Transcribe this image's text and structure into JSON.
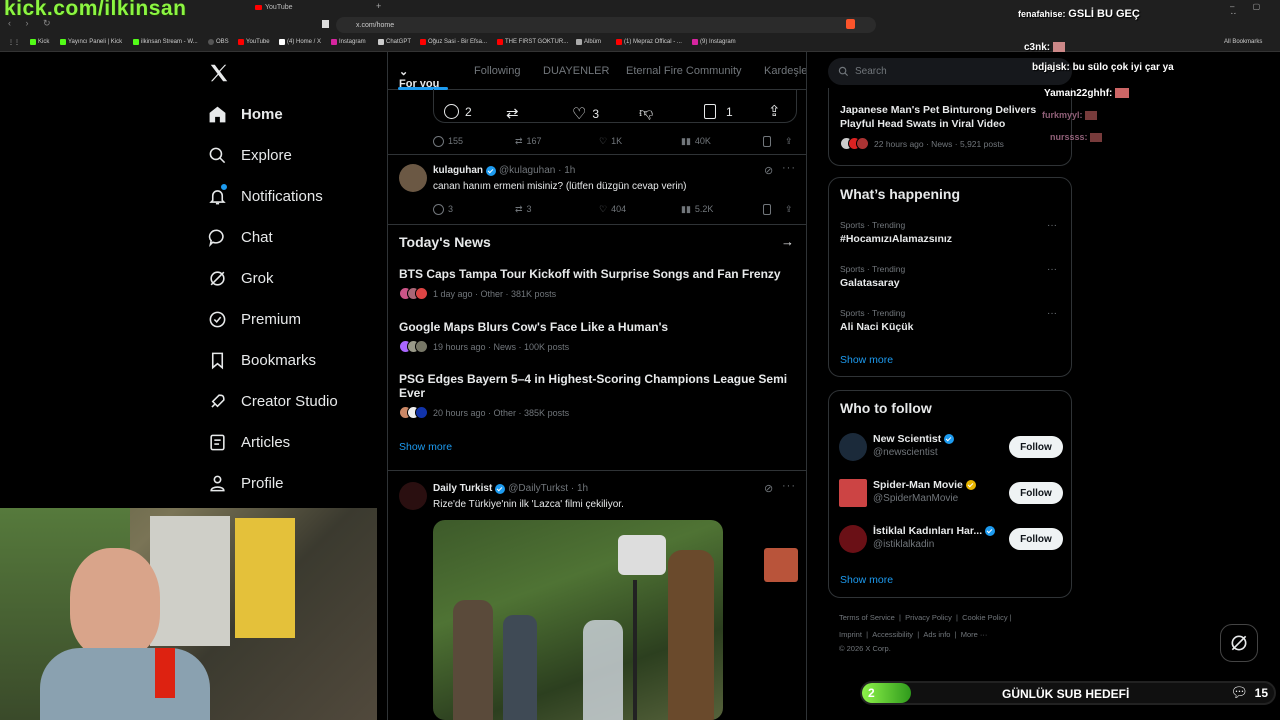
{
  "browser": {
    "overlay_text": "kick.com/ilkinsan",
    "tab_youtube": "YouTube",
    "url": "x.com/home",
    "bookmarks": [
      "Kick",
      "Yayıncı Paneli | Kick",
      "ilkinsan Stream - W...",
      "OBS",
      "YouTube",
      "(4) Home / X",
      "Instagram",
      "ChatGPT",
      "Oğuz Sasi - Bir Efsa...",
      "THE FIRST GOKTUR...",
      "Albüm",
      "(1) Mepraz Offical - ...",
      "(9) Instagram"
    ],
    "all_bookmarks": "All Bookmarks"
  },
  "nav": {
    "items": [
      "Home",
      "Explore",
      "Notifications",
      "Chat",
      "Grok",
      "Premium",
      "Bookmarks",
      "Creator Studio",
      "Articles",
      "Profile"
    ]
  },
  "tabs": [
    "For you",
    "Following",
    "DUAYENLER",
    "Eternal Fire Community",
    "Kardeşle"
  ],
  "quoted_actions": {
    "replies": "2",
    "likes": "3",
    "bookmarks": "1"
  },
  "post_top_stats": {
    "replies": "155",
    "reposts": "167",
    "likes": "1K",
    "views": "40K"
  },
  "post1": {
    "name": "kulaguhan",
    "handle": "@kulaguhan · 1h",
    "text": "canan hanım ermeni misiniz? (lütfen düzgün cevap verin)",
    "replies": "3",
    "reposts": "3",
    "likes": "404",
    "views": "5.2K"
  },
  "todays_news": {
    "title": "Today's News",
    "items": [
      {
        "title": "BTS Caps Tampa Tour Kickoff with Surprise Songs and Fan Frenzy",
        "meta": "1 day ago · Other · 381K posts"
      },
      {
        "title": "Google Maps Blurs Cow's Face Like a Human's",
        "meta": "19 hours ago · News · 100K posts"
      },
      {
        "title": "PSG Edges Bayern 5–4 in Highest-Scoring Champions League Semi Ever",
        "meta": "20 hours ago · Other · 385K posts"
      }
    ],
    "show_more": "Show more"
  },
  "post2": {
    "name": "Daily Turkist",
    "handle": "@DailyTurkst · 1h",
    "text": "Rize'de Türkiye'nin ilk 'Lazca' filmi çekiliyor."
  },
  "search": {
    "placeholder": "Search"
  },
  "top_news": {
    "title": "Japanese Man's Pet Binturong Delivers Playful Head Swats in Viral Video",
    "meta": "22 hours ago · News · 5,921 posts"
  },
  "happening": {
    "title": "What’s happening",
    "trends": [
      {
        "meta": "Sports · Trending",
        "name": "#HocamızıAlamazsınız"
      },
      {
        "meta": "Sports · Trending",
        "name": "Galatasaray"
      },
      {
        "meta": "Sports · Trending",
        "name": "Ali Naci Küçük"
      }
    ],
    "show_more": "Show more"
  },
  "who_to_follow": {
    "title": "Who to follow",
    "accounts": [
      {
        "name": "New Scientist",
        "handle": "@newscientist",
        "follow": "Follow"
      },
      {
        "name": "Spider-Man Movie",
        "handle": "@SpiderManMovie",
        "follow": "Follow"
      },
      {
        "name": "İstiklal Kadınları Har...",
        "handle": "@istiklalkadin",
        "follow": "Follow"
      }
    ],
    "show_more": "Show more"
  },
  "footer": {
    "links": [
      "Terms of Service",
      "|",
      "Privacy Policy",
      "|",
      "Cookie Policy",
      "|",
      "Imprint",
      "|",
      "Accessibility",
      "|",
      "Ads info",
      "|",
      "More ···"
    ],
    "copyright": "© 2026 X Corp."
  },
  "stream_chat": [
    {
      "user": "fenafahise:",
      "msg": "GSLİ BU GEÇ"
    },
    {
      "user": "c3nk:",
      "msg": ""
    },
    {
      "user": "bdjajsk:",
      "msg": "bu sülo çok iyi çar ya"
    },
    {
      "user": "Yaman22ghhf:",
      "msg": ""
    },
    {
      "user": "furkmyyl:",
      "msg": ""
    },
    {
      "user": "nurssss:",
      "msg": ""
    }
  ],
  "sub_goal": {
    "current": "2",
    "label": "GÜNLÜK SUB HEDEFİ",
    "target": "15",
    "progress": 0.12
  }
}
